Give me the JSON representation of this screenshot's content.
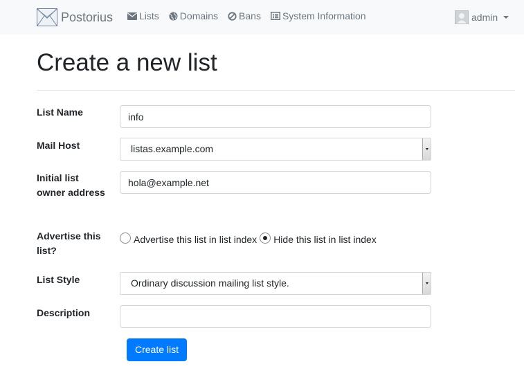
{
  "navbar": {
    "brand": "Postorius",
    "items": [
      {
        "label": "Lists",
        "icon": "envelope-icon"
      },
      {
        "label": "Domains",
        "icon": "globe-icon"
      },
      {
        "label": "Bans",
        "icon": "ban-icon"
      },
      {
        "label": "System Information",
        "icon": "list-alt-icon"
      }
    ],
    "user": "admin"
  },
  "page": {
    "title": "Create a new list"
  },
  "form": {
    "list_name": {
      "label": "List Name",
      "value": "info"
    },
    "mail_host": {
      "label": "Mail Host",
      "value": "listas.example.com"
    },
    "owner": {
      "label": "Initial list owner address",
      "value": "hola@example.net"
    },
    "advertise": {
      "label": "Advertise this list?",
      "options": [
        {
          "label": "Advertise this list in list index",
          "checked": false
        },
        {
          "label": "Hide this list in list index",
          "checked": true
        }
      ]
    },
    "list_style": {
      "label": "List Style",
      "value": "Ordinary discussion mailing list style."
    },
    "description": {
      "label": "Description",
      "value": ""
    },
    "submit_label": "Create list"
  },
  "colors": {
    "primary": "#007bff",
    "navbar_bg": "#f8f9fa",
    "nav_text": "#6c757d"
  }
}
